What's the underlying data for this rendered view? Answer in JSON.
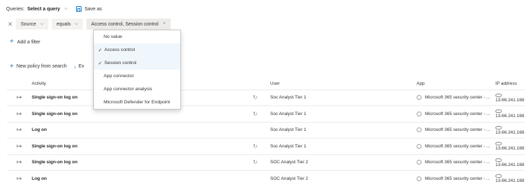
{
  "queries": {
    "label": "Queries:",
    "value": "Select a query",
    "save_label": "Save as"
  },
  "filter": {
    "field": "Source",
    "operator": "equals",
    "value": "Access control, Session control"
  },
  "add_filter_label": "Add a filter",
  "toolbar": {
    "new_policy_label": "New policy from search",
    "export_label": "Ex"
  },
  "dropdown": {
    "options": [
      {
        "label": "No value",
        "selected": false
      },
      {
        "label": "Access control",
        "selected": true
      },
      {
        "label": "Session control",
        "selected": true
      },
      {
        "label": "App connector",
        "selected": false
      },
      {
        "label": "App connector analysis",
        "selected": false
      },
      {
        "label": "Microsoft Defender for Endpoint",
        "selected": false
      }
    ]
  },
  "table": {
    "columns": [
      "Activity",
      "User",
      "App",
      "IP address"
    ],
    "rows": [
      {
        "activity": "Single sign-on log on",
        "user": "Soc Analyst Tier 1",
        "app": "Microsoft 365 security center - ...",
        "ip": "13.66.241.168",
        "spinner": true
      },
      {
        "activity": "Single sign-on log on",
        "user": "Soc Analyst Tier 1",
        "app": "Microsoft 365 security center - ...",
        "ip": "13.66.241.168",
        "spinner": true
      },
      {
        "activity": "Log on",
        "user": "Soc Analyst Tier 1",
        "app": "Microsoft 365 security center - ...",
        "ip": "13.66.241.168",
        "spinner": false
      },
      {
        "activity": "Single sign-on log on",
        "user": "Soc Analyst Tier 1",
        "app": "Microsoft 365 security center - ...",
        "ip": "13.66.241.168",
        "spinner": true
      },
      {
        "activity": "Single sign-on log on",
        "user": "SOC Analyst Tier 2",
        "app": "Microsoft 365 security center - ...",
        "ip": "13.66.241.168",
        "spinner": true
      },
      {
        "activity": "Log on",
        "user": "SOC Analyst Tier 2",
        "app": "Microsoft 365 security center - ...",
        "ip": "13.66.241.168",
        "spinner": false
      }
    ]
  },
  "colors": {
    "accent": "#0078d4",
    "selected_bg": "#eff6fc",
    "pill_bg": "#f3f2f1"
  },
  "icons": {
    "save": "save-icon",
    "clear": "close-icon",
    "add": "plus-icon",
    "export": "download-icon",
    "activity": "sign-in-icon",
    "app": "app-circle-icon",
    "ip": "cloud-icon",
    "spinner": "refresh-icon"
  }
}
